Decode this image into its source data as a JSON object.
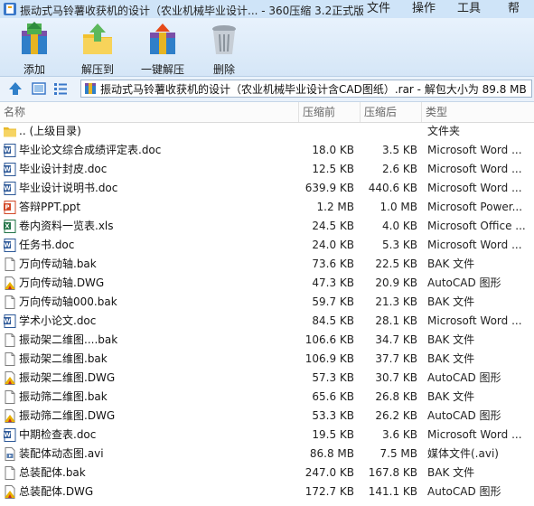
{
  "window": {
    "title": "振动式马铃薯收获机的设计（农业机械毕业设计... - 360压缩 3.2正式版",
    "menu": {
      "file": "文件",
      "operation": "操作",
      "tools": "工具",
      "help": "帮"
    }
  },
  "toolbar": {
    "add_label": "添加",
    "extract_label": "解压到",
    "onekey_label": "一键解压",
    "delete_label": "删除"
  },
  "address": {
    "path": "振动式马铃薯收获机的设计（农业机械毕业设计含CAD图纸）.rar - 解包大小为 89.8 MB"
  },
  "columns": {
    "name": "名称",
    "size": "压缩前",
    "packed": "压缩后",
    "type": "类型"
  },
  "files": [
    {
      "icon": "folder",
      "name": ".. (上级目录)",
      "size": "",
      "packed": "",
      "type": "文件夹"
    },
    {
      "icon": "word",
      "name": "毕业论文综合成绩评定表.doc",
      "size": "18.0 KB",
      "packed": "3.5 KB",
      "type": "Microsoft Word ..."
    },
    {
      "icon": "word",
      "name": "毕业设计封皮.doc",
      "size": "12.5 KB",
      "packed": "2.6 KB",
      "type": "Microsoft Word ..."
    },
    {
      "icon": "word",
      "name": "毕业设计说明书.doc",
      "size": "639.9 KB",
      "packed": "440.6 KB",
      "type": "Microsoft Word ..."
    },
    {
      "icon": "ppt",
      "name": "答辩PPT.ppt",
      "size": "1.2 MB",
      "packed": "1.0 MB",
      "type": "Microsoft Power..."
    },
    {
      "icon": "excel",
      "name": "卷内资料一览表.xls",
      "size": "24.5 KB",
      "packed": "4.0 KB",
      "type": "Microsoft Office ..."
    },
    {
      "icon": "word",
      "name": "任务书.doc",
      "size": "24.0 KB",
      "packed": "5.3 KB",
      "type": "Microsoft Word ..."
    },
    {
      "icon": "bak",
      "name": "万向传动轴.bak",
      "size": "73.6 KB",
      "packed": "22.5 KB",
      "type": "BAK 文件"
    },
    {
      "icon": "dwg",
      "name": "万向传动轴.DWG",
      "size": "47.3 KB",
      "packed": "20.9 KB",
      "type": "AutoCAD 图形"
    },
    {
      "icon": "bak",
      "name": "万向传动轴000.bak",
      "size": "59.7 KB",
      "packed": "21.3 KB",
      "type": "BAK 文件"
    },
    {
      "icon": "word",
      "name": "学术小论文.doc",
      "size": "84.5 KB",
      "packed": "28.1 KB",
      "type": "Microsoft Word ..."
    },
    {
      "icon": "bak",
      "name": "振动架二维图....bak",
      "size": "106.6 KB",
      "packed": "34.7 KB",
      "type": "BAK 文件"
    },
    {
      "icon": "bak",
      "name": "振动架二维图.bak",
      "size": "106.9 KB",
      "packed": "37.7 KB",
      "type": "BAK 文件"
    },
    {
      "icon": "dwg",
      "name": "振动架二维图.DWG",
      "size": "57.3 KB",
      "packed": "30.7 KB",
      "type": "AutoCAD 图形"
    },
    {
      "icon": "bak",
      "name": "振动筛二维图.bak",
      "size": "65.6 KB",
      "packed": "26.8 KB",
      "type": "BAK 文件"
    },
    {
      "icon": "dwg",
      "name": "振动筛二维图.DWG",
      "size": "53.3 KB",
      "packed": "26.2 KB",
      "type": "AutoCAD 图形"
    },
    {
      "icon": "word",
      "name": "中期检查表.doc",
      "size": "19.5 KB",
      "packed": "3.6 KB",
      "type": "Microsoft Word ..."
    },
    {
      "icon": "avi",
      "name": "装配体动态图.avi",
      "size": "86.8 MB",
      "packed": "7.5 MB",
      "type": "媒体文件(.avi)"
    },
    {
      "icon": "bak",
      "name": "总装配体.bak",
      "size": "247.0 KB",
      "packed": "167.8 KB",
      "type": "BAK 文件"
    },
    {
      "icon": "dwg",
      "name": "总装配体.DWG",
      "size": "172.7 KB",
      "packed": "141.1 KB",
      "type": "AutoCAD 图形"
    }
  ],
  "colors": {
    "titlebar": "#cfe4f8",
    "toolbar": "#dceaf8",
    "word_blue": "#2b5797",
    "ppt_red": "#d24726",
    "excel_green": "#217346",
    "dwg_yellow": "#e8b100"
  }
}
